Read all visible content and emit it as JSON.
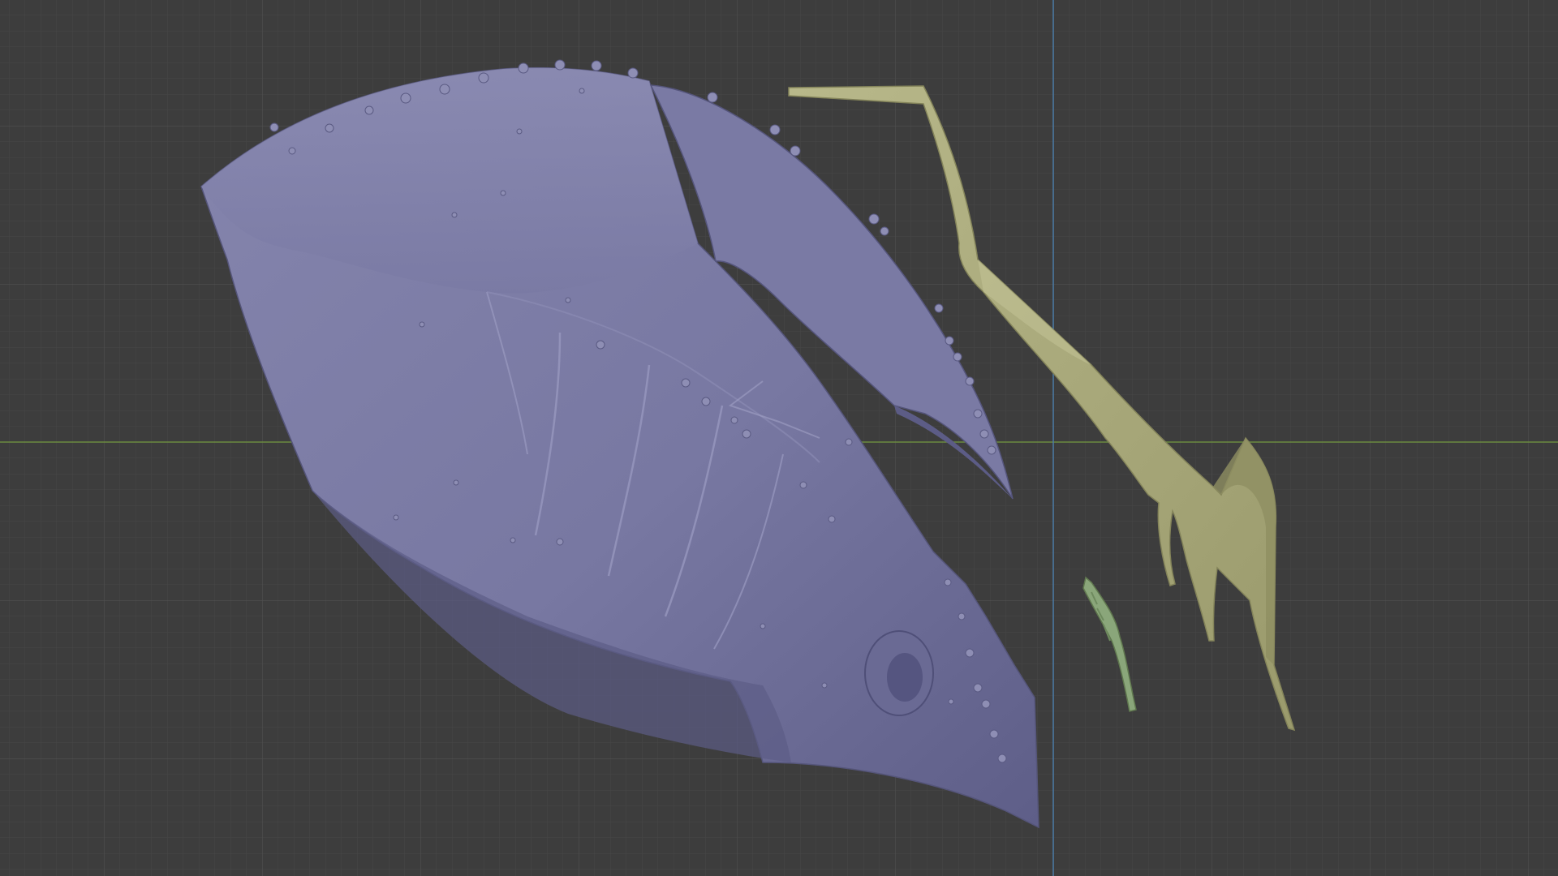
{
  "viewport": {
    "background_color": "#3d3d3d",
    "grid_minor_color": "#474747",
    "grid_major_color": "#525252",
    "axis_x_color": "#6a8a3e",
    "axis_y_color": "#4a7aa6"
  },
  "objects": [
    {
      "name": "helmet-main",
      "color": "#7c7ca6"
    },
    {
      "name": "helmet-side-plate",
      "color": "#7a7aa4"
    },
    {
      "name": "helmet-cheek-guard",
      "color": "#5f5f88"
    },
    {
      "name": "olive-spine-piece",
      "color": "#b0b080"
    },
    {
      "name": "green-small-fin",
      "color": "#8aa67a"
    }
  ]
}
